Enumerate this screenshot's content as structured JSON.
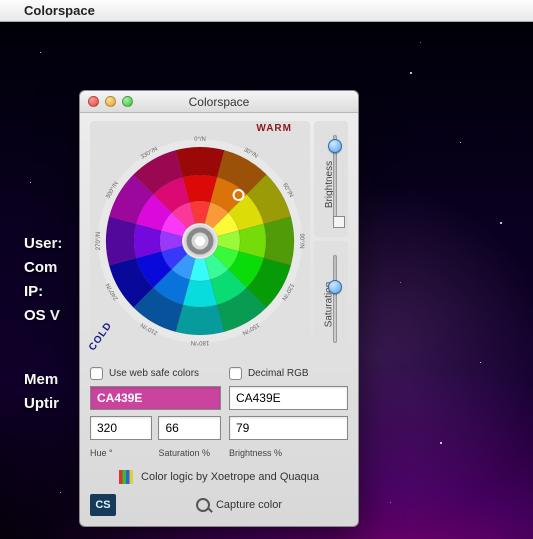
{
  "menubar": {
    "apple": "",
    "app_name": "Colorspace"
  },
  "desktop_info": {
    "line1": "User:",
    "line2": "Com",
    "line3": "IP:",
    "line4": "OS V",
    "line5": "Mem",
    "line6": "Uptir"
  },
  "window": {
    "title": "Colorspace",
    "wheel": {
      "warm_label": "WARM",
      "cold_label": "COLD",
      "degree_ticks": [
        "0°/N",
        "30°/N",
        "60°/N",
        "90°/N",
        "120°/N",
        "150°/N",
        "180°/N",
        "210°/N",
        "240°/N",
        "270°/N",
        "300°/N",
        "330°/N"
      ]
    },
    "sliders": {
      "brightness_label": "Brightness",
      "saturation_label": "Saturation",
      "brightness_pos_pct": 12,
      "saturation_pos_pct": 36
    },
    "options": {
      "websafe_label": "Use web safe colors",
      "decimal_label": "Decimal RGB"
    },
    "values": {
      "hex_left": "CA439E",
      "hex_right": "CA439E",
      "hue": "320",
      "saturation": "66",
      "brightness": "79",
      "swatch_color": "#CA439E"
    },
    "labels": {
      "hue": "Hue °",
      "saturation": "Saturation %",
      "brightness": "Brightness %"
    },
    "credit": "Color logic by Xoetrope and Quaqua",
    "cs_badge": "CS",
    "capture_label": "Capture color"
  }
}
